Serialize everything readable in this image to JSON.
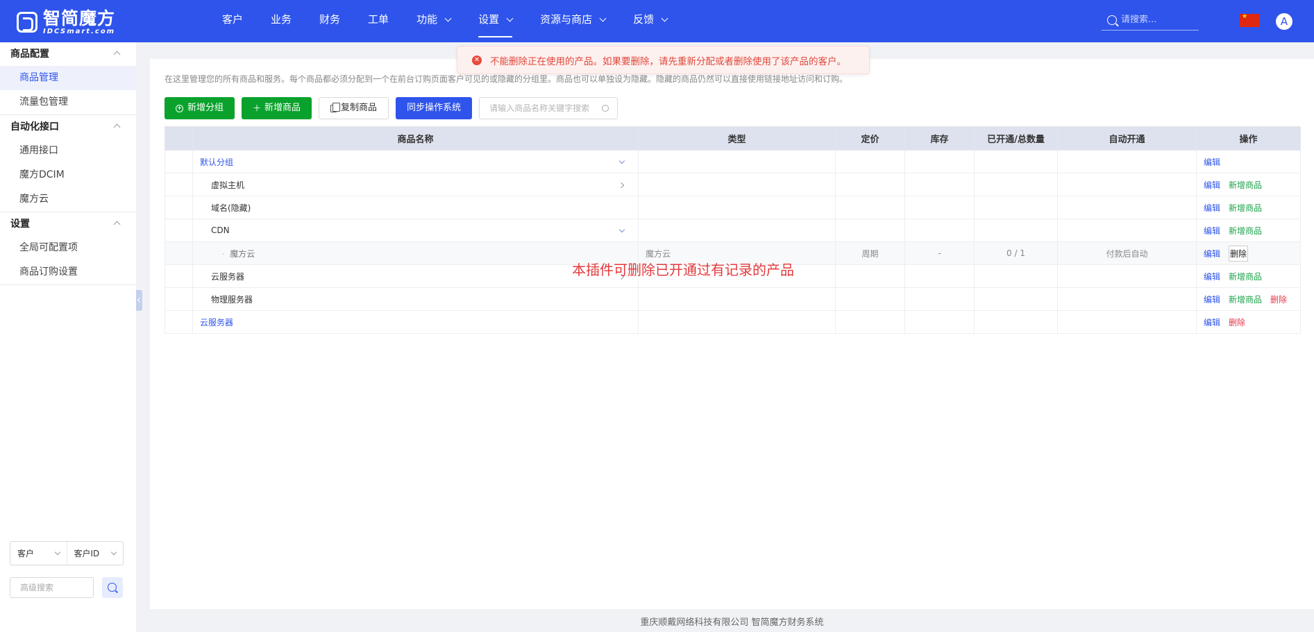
{
  "brand": {
    "name_cn": "智简魔方",
    "name_en": "IDCSmart.com"
  },
  "nav": [
    {
      "label": "客户",
      "dropdown": false,
      "active": false
    },
    {
      "label": "业务",
      "dropdown": false,
      "active": false
    },
    {
      "label": "财务",
      "dropdown": false,
      "active": false
    },
    {
      "label": "工单",
      "dropdown": false,
      "active": false
    },
    {
      "label": "功能",
      "dropdown": true,
      "active": false
    },
    {
      "label": "设置",
      "dropdown": true,
      "active": true
    },
    {
      "label": "资源与商店",
      "dropdown": true,
      "active": false
    },
    {
      "label": "反馈",
      "dropdown": true,
      "active": false
    }
  ],
  "top_search": {
    "placeholder": "请搜索..."
  },
  "avatar_letter": "A",
  "sidebar": {
    "groups": [
      {
        "title": "商品配置",
        "items": [
          {
            "label": "商品管理",
            "active": true
          },
          {
            "label": "流量包管理",
            "active": false
          }
        ]
      },
      {
        "title": "自动化接口",
        "items": [
          {
            "label": "通用接口",
            "active": false
          },
          {
            "label": "魔方DCIM",
            "active": false
          },
          {
            "label": "魔方云",
            "active": false
          }
        ]
      },
      {
        "title": "设置",
        "items": [
          {
            "label": "全局可配置项",
            "active": false
          },
          {
            "label": "商品订购设置",
            "active": false
          }
        ]
      }
    ],
    "filter_type": "客户",
    "filter_field": "客户ID",
    "advanced_search_placeholder": "高级搜索"
  },
  "alert": {
    "message": "不能删除正在使用的产品。如果要删除，请先重新分配或者删除使用了该产品的客户。"
  },
  "description": "在这里管理您的所有商品和服务。每个商品都必须分配到一个在前台订购页面客户可见的或隐藏的分组里。商品也可以单独设为隐藏。隐藏的商品仍然可以直接使用链接地址访问和订购。",
  "toolbar": {
    "add_group": "新增分组",
    "add_product": "新增商品",
    "copy_product": "复制商品",
    "sync_os": "同步操作系统",
    "search_placeholder": "请输入商品名称关键字搜索"
  },
  "table": {
    "headers": {
      "name": "商品名称",
      "type": "类型",
      "price": "定价",
      "stock": "库存",
      "count": "已开通/总数量",
      "auto": "自动开通",
      "ops": "操作"
    },
    "rows": [
      {
        "name": "默认分组",
        "level": "grp",
        "type": "",
        "price": "",
        "stock": "",
        "count": "",
        "auto": "",
        "toggle": "down",
        "ops": [
          "edit"
        ]
      },
      {
        "name": "虚拟主机",
        "level": "l2",
        "type": "",
        "price": "",
        "stock": "",
        "count": "",
        "auto": "",
        "toggle": "right",
        "ops": [
          "edit",
          "add"
        ]
      },
      {
        "name": "域名(隐藏)",
        "level": "l2",
        "type": "",
        "price": "",
        "stock": "",
        "count": "",
        "auto": "",
        "toggle": "",
        "ops": [
          "edit",
          "add"
        ]
      },
      {
        "name": "CDN",
        "level": "l2",
        "type": "",
        "price": "",
        "stock": "",
        "count": "",
        "auto": "",
        "toggle": "down",
        "ops": [
          "edit",
          "add"
        ]
      },
      {
        "name": "魔方云",
        "level": "l3",
        "type": "魔方云",
        "price": "周期",
        "stock": "-",
        "count": "0 / 1",
        "auto": "付款后自动",
        "toggle": "",
        "ops": [
          "edit",
          "delbox"
        ]
      },
      {
        "name": "云服务器",
        "level": "l2",
        "type": "",
        "price": "",
        "stock": "",
        "count": "",
        "auto": "",
        "toggle": "right",
        "ops": [
          "edit",
          "add"
        ]
      },
      {
        "name": "物理服务器",
        "level": "l2",
        "type": "",
        "price": "",
        "stock": "",
        "count": "",
        "auto": "",
        "toggle": "",
        "ops": [
          "edit",
          "add",
          "del"
        ]
      },
      {
        "name": "云服务器",
        "level": "grp",
        "type": "",
        "price": "",
        "stock": "",
        "count": "",
        "auto": "",
        "toggle": "",
        "ops": [
          "edit",
          "del"
        ]
      }
    ],
    "op_labels": {
      "edit": "编辑",
      "add": "新增商品",
      "del": "删除"
    }
  },
  "notice": "本插件可删除已开通过有记录的产品",
  "footer": "重庆顺戴网络科技有限公司 智简魔方财务系统",
  "colors": {
    "primary": "#2f54eb",
    "success": "#0aa22c",
    "danger": "#e4394c"
  }
}
